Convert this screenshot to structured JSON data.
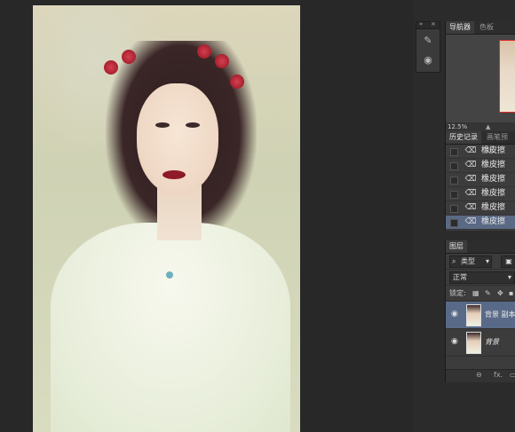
{
  "navigator": {
    "tabs": [
      {
        "label": "导航器"
      },
      {
        "label": "色板"
      }
    ],
    "zoom": "12.5%"
  },
  "history": {
    "tabs": [
      {
        "label": "历史记录"
      },
      {
        "label": "画笔预设"
      }
    ],
    "items": [
      {
        "label": "橡皮擦",
        "icon": "eraser-icon"
      },
      {
        "label": "橡皮擦",
        "icon": "eraser-icon"
      },
      {
        "label": "橡皮擦",
        "icon": "eraser-icon"
      },
      {
        "label": "橡皮擦",
        "icon": "eraser-icon"
      },
      {
        "label": "橡皮擦",
        "icon": "eraser-icon"
      },
      {
        "label": "橡皮擦",
        "icon": "eraser-icon"
      }
    ],
    "selected_index": 5
  },
  "layers": {
    "tab": "图层",
    "filter_label": "类型",
    "blend_mode": "正常",
    "lock_label": "锁定:",
    "items": [
      {
        "name": "背景 副本",
        "selected": true
      },
      {
        "name": "背景",
        "selected": false
      }
    ],
    "footer": {
      "link_glyph": "⊖",
      "fx": "fx."
    }
  },
  "colors": {
    "selection": "#596a88",
    "panel": "#3c3c3c",
    "background": "#282828"
  }
}
